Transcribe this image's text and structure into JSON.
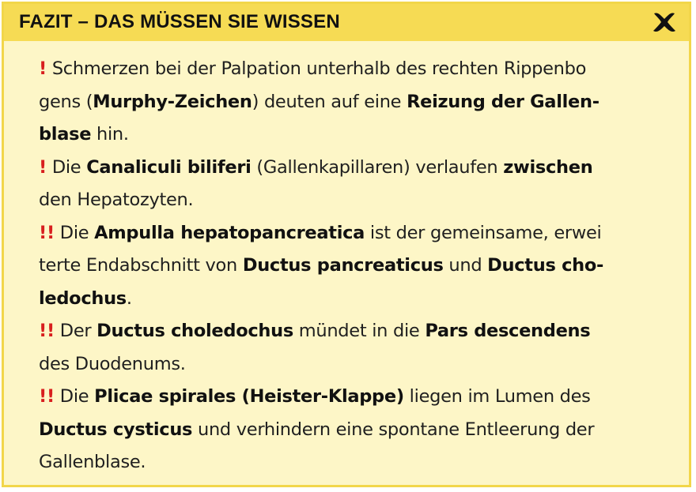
{
  "title": "FAZIT – DAS MÜSSEN SIE WISSEN",
  "close_icon": "close-x-icon",
  "colors": {
    "header": "#f6db54",
    "background": "#fdf6c7",
    "border": "#f2d64a",
    "marker": "#d81e1e"
  },
  "items": [
    {
      "marker": "!",
      "lines": [
        [
          {
            "t": "Schmerzen bei der Palpation unterhalb des rechten Rippenbo",
            "b": false
          }
        ],
        [
          {
            "t": "gens (",
            "b": false
          },
          {
            "t": "Murphy-Zeichen",
            "b": true
          },
          {
            "t": ") deuten auf eine ",
            "b": false
          },
          {
            "t": "Reizung der Gallen-",
            "b": true
          }
        ],
        [
          {
            "t": "blase",
            "b": true
          },
          {
            "t": " hin.",
            "b": false
          }
        ]
      ]
    },
    {
      "marker": "!",
      "lines": [
        [
          {
            "t": "Die ",
            "b": false
          },
          {
            "t": "Canaliculi biliferi",
            "b": true
          },
          {
            "t": " (Gallenkapillaren) verlaufen ",
            "b": false
          },
          {
            "t": "zwischen",
            "b": true
          }
        ],
        [
          {
            "t": "den Hepatozyten.",
            "b": false
          }
        ]
      ]
    },
    {
      "marker": "!!",
      "lines": [
        [
          {
            "t": "Die ",
            "b": false
          },
          {
            "t": "Ampulla hepatopancreatica",
            "b": true
          },
          {
            "t": " ist der gemeinsame, erwei",
            "b": false
          }
        ],
        [
          {
            "t": "terte Endabschnitt von ",
            "b": false
          },
          {
            "t": "Ductus pancreaticus",
            "b": true
          },
          {
            "t": " und ",
            "b": false
          },
          {
            "t": "Ductus cho-",
            "b": true
          }
        ],
        [
          {
            "t": "ledochus",
            "b": true
          },
          {
            "t": ".",
            "b": false
          }
        ]
      ]
    },
    {
      "marker": "!!",
      "lines": [
        [
          {
            "t": "Der ",
            "b": false
          },
          {
            "t": "Ductus choledochus",
            "b": true
          },
          {
            "t": " mündet in die ",
            "b": false
          },
          {
            "t": "Pars descendens",
            "b": true
          }
        ],
        [
          {
            "t": "des Duodenums.",
            "b": false
          }
        ]
      ]
    },
    {
      "marker": "!!",
      "lines": [
        [
          {
            "t": "Die ",
            "b": false
          },
          {
            "t": "Plicae spirales (Heister-Klappe)",
            "b": true
          },
          {
            "t": " liegen im Lumen des",
            "b": false
          }
        ],
        [
          {
            "t": "Ductus cysticus",
            "b": true
          },
          {
            "t": " und verhindern eine spontane Entleerung der",
            "b": false
          }
        ],
        [
          {
            "t": "Gallenblase.",
            "b": false
          }
        ]
      ]
    }
  ]
}
